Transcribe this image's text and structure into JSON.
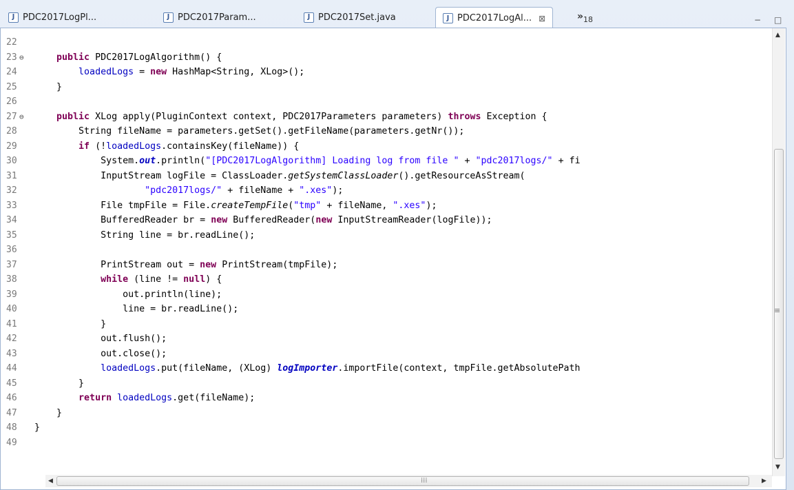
{
  "tabs": [
    {
      "label": "PDC2017LogPl...",
      "active": false
    },
    {
      "label": "PDC2017Param...",
      "active": false
    },
    {
      "label": "PDC2017Set.java",
      "active": false
    },
    {
      "label": "PDC2017LogAl...",
      "active": true
    }
  ],
  "tab_icon": "java-file-icon",
  "tab_icon_glyph": "J",
  "close_glyph": "⊠",
  "overflow": {
    "chevron": "»",
    "count": "18"
  },
  "window_controls": {
    "minimize": "−",
    "maximize": "□"
  },
  "scroll_arrows": {
    "up": "▲",
    "down": "▼",
    "left": "◀",
    "right": "▶",
    "grip_v": "≡",
    "grip_h": "⁞⁞⁞"
  },
  "colors": {
    "keyword": "#7f0055",
    "string": "#2a00ff",
    "field": "#0000c0",
    "line_number": "#787878"
  },
  "code_lines": [
    {
      "n": "22",
      "fold": "",
      "segs": [
        {
          "t": "",
          "c": ""
        }
      ]
    },
    {
      "n": "23",
      "fold": "⊖",
      "segs": [
        {
          "t": "    ",
          "c": ""
        },
        {
          "t": "public",
          "c": "kw"
        },
        {
          "t": " PDC2017LogAlgorithm() {",
          "c": ""
        }
      ]
    },
    {
      "n": "24",
      "fold": "",
      "segs": [
        {
          "t": "        ",
          "c": ""
        },
        {
          "t": "loadedLogs",
          "c": "fld"
        },
        {
          "t": " = ",
          "c": ""
        },
        {
          "t": "new",
          "c": "kw"
        },
        {
          "t": " HashMap<String, XLog>();",
          "c": ""
        }
      ]
    },
    {
      "n": "25",
      "fold": "",
      "segs": [
        {
          "t": "    }",
          "c": ""
        }
      ]
    },
    {
      "n": "26",
      "fold": "",
      "segs": [
        {
          "t": "",
          "c": ""
        }
      ]
    },
    {
      "n": "27",
      "fold": "⊖",
      "segs": [
        {
          "t": "    ",
          "c": ""
        },
        {
          "t": "public",
          "c": "kw"
        },
        {
          "t": " XLog apply(PluginContext context, PDC2017Parameters parameters) ",
          "c": ""
        },
        {
          "t": "throws",
          "c": "kw"
        },
        {
          "t": " Exception {",
          "c": ""
        }
      ]
    },
    {
      "n": "28",
      "fold": "",
      "segs": [
        {
          "t": "        String fileName = parameters.getSet().getFileName(parameters.getNr());",
          "c": ""
        }
      ]
    },
    {
      "n": "29",
      "fold": "",
      "segs": [
        {
          "t": "        ",
          "c": ""
        },
        {
          "t": "if",
          "c": "kw"
        },
        {
          "t": " (!",
          "c": ""
        },
        {
          "t": "loadedLogs",
          "c": "fld"
        },
        {
          "t": ".containsKey(fileName)) {",
          "c": ""
        }
      ]
    },
    {
      "n": "30",
      "fold": "",
      "segs": [
        {
          "t": "            System.",
          "c": ""
        },
        {
          "t": "out",
          "c": "sfld"
        },
        {
          "t": ".println(",
          "c": ""
        },
        {
          "t": "\"[PDC2017LogAlgorithm] Loading log from file \"",
          "c": "str"
        },
        {
          "t": " + ",
          "c": ""
        },
        {
          "t": "\"pdc2017logs/\"",
          "c": "str"
        },
        {
          "t": " + fi",
          "c": ""
        }
      ]
    },
    {
      "n": "31",
      "fold": "",
      "segs": [
        {
          "t": "            InputStream logFile = ClassLoader.",
          "c": ""
        },
        {
          "t": "getSystemClassLoader",
          "c": "smeth"
        },
        {
          "t": "().getResourceAsStream(",
          "c": ""
        }
      ]
    },
    {
      "n": "32",
      "fold": "",
      "segs": [
        {
          "t": "                    ",
          "c": ""
        },
        {
          "t": "\"pdc2017logs/\"",
          "c": "str"
        },
        {
          "t": " + fileName + ",
          "c": ""
        },
        {
          "t": "\".xes\"",
          "c": "str"
        },
        {
          "t": ");",
          "c": ""
        }
      ]
    },
    {
      "n": "33",
      "fold": "",
      "segs": [
        {
          "t": "            File tmpFile = File.",
          "c": ""
        },
        {
          "t": "createTempFile",
          "c": "smeth"
        },
        {
          "t": "(",
          "c": ""
        },
        {
          "t": "\"tmp\"",
          "c": "str"
        },
        {
          "t": " + fileName, ",
          "c": ""
        },
        {
          "t": "\".xes\"",
          "c": "str"
        },
        {
          "t": ");",
          "c": ""
        }
      ]
    },
    {
      "n": "34",
      "fold": "",
      "segs": [
        {
          "t": "            BufferedReader br = ",
          "c": ""
        },
        {
          "t": "new",
          "c": "kw"
        },
        {
          "t": " BufferedReader(",
          "c": ""
        },
        {
          "t": "new",
          "c": "kw"
        },
        {
          "t": " InputStreamReader(logFile));",
          "c": ""
        }
      ]
    },
    {
      "n": "35",
      "fold": "",
      "segs": [
        {
          "t": "            String line = br.readLine();",
          "c": ""
        }
      ]
    },
    {
      "n": "36",
      "fold": "",
      "segs": [
        {
          "t": "",
          "c": ""
        }
      ]
    },
    {
      "n": "37",
      "fold": "",
      "segs": [
        {
          "t": "            PrintStream out = ",
          "c": ""
        },
        {
          "t": "new",
          "c": "kw"
        },
        {
          "t": " PrintStream(tmpFile);",
          "c": ""
        }
      ]
    },
    {
      "n": "38",
      "fold": "",
      "segs": [
        {
          "t": "            ",
          "c": ""
        },
        {
          "t": "while",
          "c": "kw"
        },
        {
          "t": " (line != ",
          "c": ""
        },
        {
          "t": "null",
          "c": "kw"
        },
        {
          "t": ") {",
          "c": ""
        }
      ]
    },
    {
      "n": "39",
      "fold": "",
      "segs": [
        {
          "t": "                out.println(line);",
          "c": ""
        }
      ]
    },
    {
      "n": "40",
      "fold": "",
      "segs": [
        {
          "t": "                line = br.readLine();",
          "c": ""
        }
      ]
    },
    {
      "n": "41",
      "fold": "",
      "segs": [
        {
          "t": "            }",
          "c": ""
        }
      ]
    },
    {
      "n": "42",
      "fold": "",
      "segs": [
        {
          "t": "            out.flush();",
          "c": ""
        }
      ]
    },
    {
      "n": "43",
      "fold": "",
      "segs": [
        {
          "t": "            out.close();",
          "c": ""
        }
      ]
    },
    {
      "n": "44",
      "fold": "",
      "segs": [
        {
          "t": "            ",
          "c": ""
        },
        {
          "t": "loadedLogs",
          "c": "fld"
        },
        {
          "t": ".put(fileName, (XLog) ",
          "c": ""
        },
        {
          "t": "logImporter",
          "c": "sfld"
        },
        {
          "t": ".importFile(context, tmpFile.getAbsolutePath",
          "c": ""
        }
      ]
    },
    {
      "n": "45",
      "fold": "",
      "segs": [
        {
          "t": "        }",
          "c": ""
        }
      ]
    },
    {
      "n": "46",
      "fold": "",
      "segs": [
        {
          "t": "        ",
          "c": ""
        },
        {
          "t": "return",
          "c": "kw"
        },
        {
          "t": " ",
          "c": ""
        },
        {
          "t": "loadedLogs",
          "c": "fld"
        },
        {
          "t": ".get(fileName);",
          "c": ""
        }
      ]
    },
    {
      "n": "47",
      "fold": "",
      "segs": [
        {
          "t": "    }",
          "c": ""
        }
      ]
    },
    {
      "n": "48",
      "fold": "",
      "segs": [
        {
          "t": "}",
          "c": ""
        }
      ]
    },
    {
      "n": "49",
      "fold": "",
      "segs": [
        {
          "t": "",
          "c": ""
        }
      ]
    }
  ]
}
